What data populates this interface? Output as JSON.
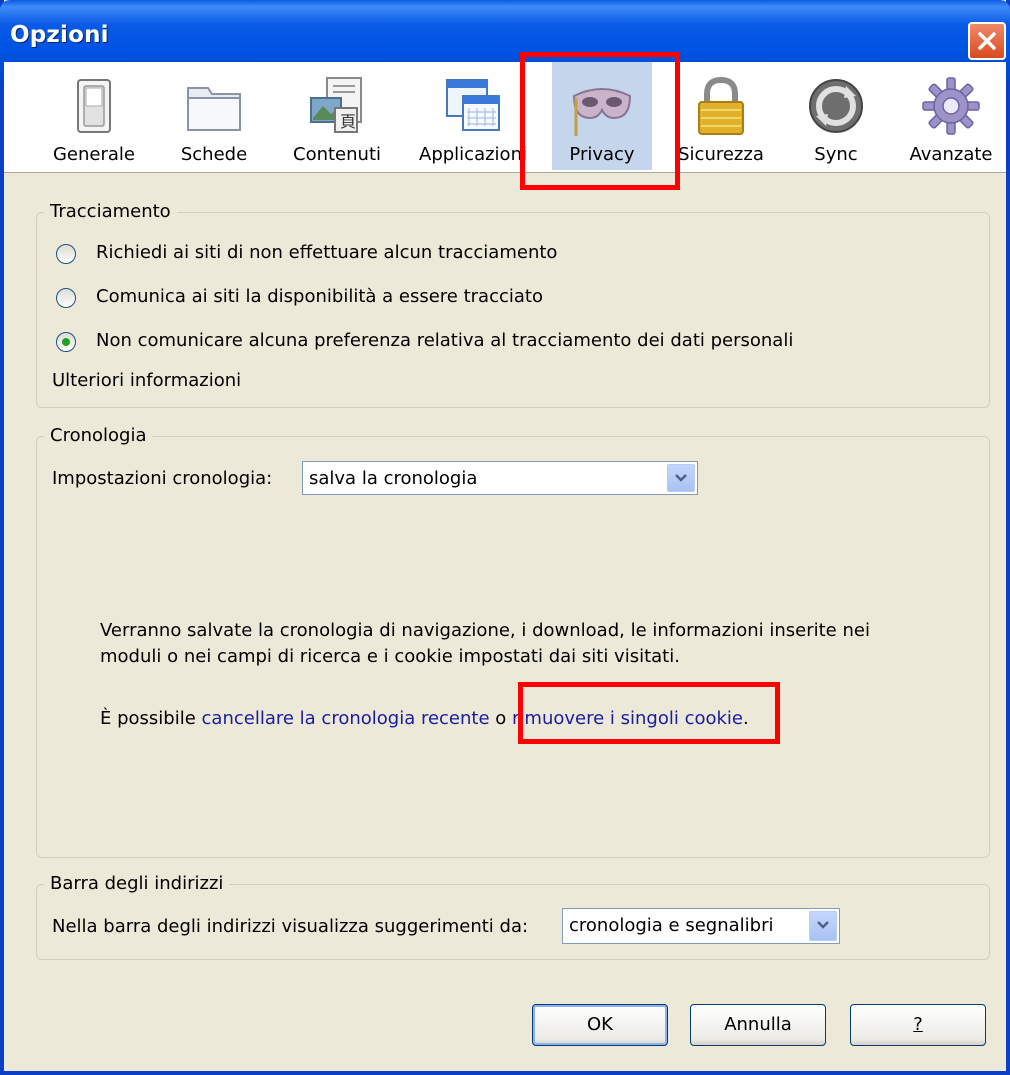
{
  "window": {
    "title": "Opzioni"
  },
  "toolbar": {
    "items": [
      {
        "label": "Generale",
        "icon": "switch-icon"
      },
      {
        "label": "Schede",
        "icon": "tabs-folder-icon"
      },
      {
        "label": "Contenuti",
        "icon": "content-icon"
      },
      {
        "label": "Applicazioni",
        "icon": "applications-icon"
      },
      {
        "label": "Privacy",
        "icon": "mask-icon",
        "selected": true
      },
      {
        "label": "Sicurezza",
        "icon": "padlock-icon"
      },
      {
        "label": "Sync",
        "icon": "sync-icon"
      },
      {
        "label": "Avanzate",
        "icon": "gear-icon"
      }
    ]
  },
  "tracking": {
    "legend": "Tracciamento",
    "options": [
      {
        "label": "Richiedi ai siti di non effettuare alcun tracciamento",
        "checked": false
      },
      {
        "label": "Comunica ai siti la disponibilità a essere tracciato",
        "checked": false
      },
      {
        "label": "Non comunicare alcuna preferenza relativa al tracciamento dei dati personali",
        "checked": true
      }
    ],
    "more_info": "Ulteriori informazioni"
  },
  "history": {
    "legend": "Cronologia",
    "setting_label": "Impostazioni cronologia:",
    "setting_value": "salva la cronologia",
    "description_line1": "Verranno salvate la cronologia di navigazione, i download, le informazioni inserite nei",
    "description_line2": "moduli o nei campi di ricerca e i cookie impostati dai siti visitati.",
    "possible_prefix": "È possibile",
    "clear_recent_link": "cancellare la cronologia recente",
    "or_text": "o",
    "remove_cookies_link": "rimuovere i singoli cookie",
    "period": "."
  },
  "address_bar": {
    "legend": "Barra degli indirizzi",
    "suggest_label": "Nella barra degli indirizzi visualizza suggerimenti da:",
    "suggest_value": "cronologia e segnalibri"
  },
  "buttons": {
    "ok": "OK",
    "cancel": "Annulla",
    "help": "?"
  },
  "colors": {
    "highlight": "#ff0000",
    "link": "#1b1ba0",
    "titlebar": "#0054e3",
    "dialog_bg": "#ece9d8"
  }
}
